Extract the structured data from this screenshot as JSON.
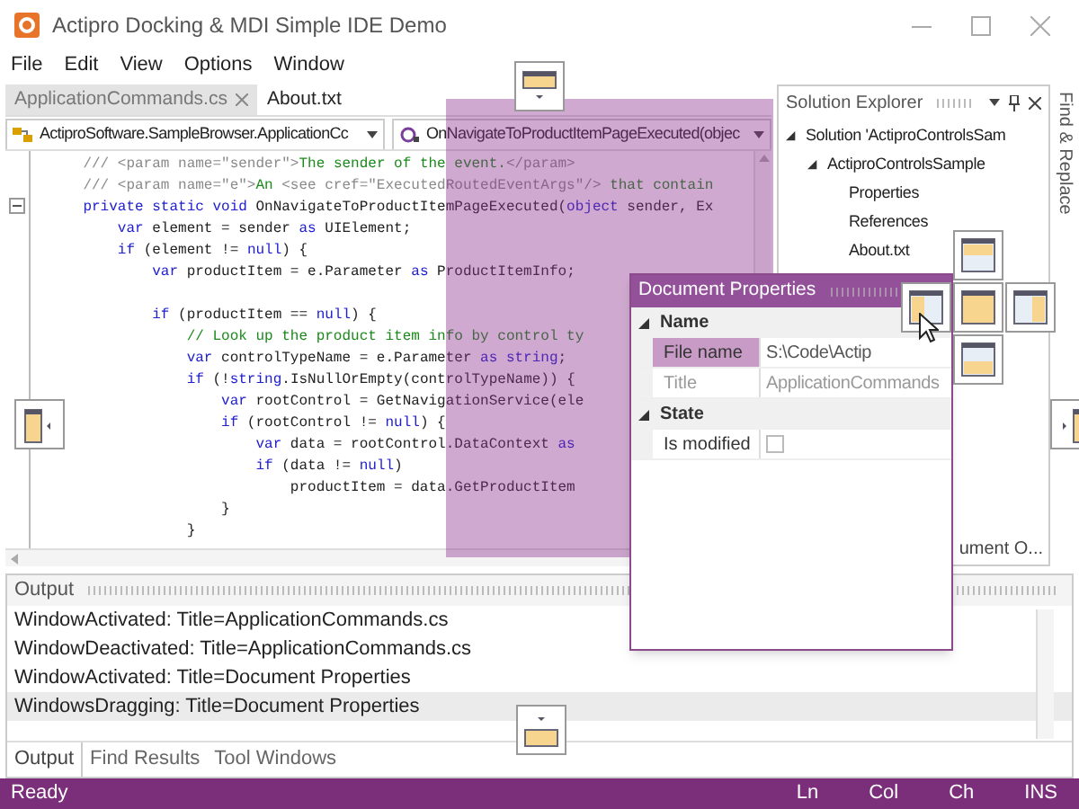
{
  "window": {
    "title": "Actipro Docking & MDI Simple IDE Demo"
  },
  "menu": [
    "File",
    "Edit",
    "View",
    "Options",
    "Window"
  ],
  "document_tabs": [
    {
      "label": "ApplicationCommands.cs",
      "selected": false,
      "closable": true
    },
    {
      "label": "About.txt",
      "selected": true,
      "closable": false
    }
  ],
  "navigation": [
    {
      "kind": "class",
      "text": "ActiproSoftware.SampleBrowser.ApplicationCc"
    },
    {
      "kind": "method",
      "text": "OnNavigateToProductItemPageExecuted(objec"
    }
  ],
  "editor": {
    "lines": [
      {
        "kind": "code",
        "segments": [
          {
            "kind": "doc",
            "text": "    /// <param name=\"sender\">"
          },
          {
            "kind": "comment",
            "text": "The sender of the event."
          },
          {
            "kind": "doc",
            "text": "</param>"
          }
        ]
      },
      {
        "kind": "code",
        "segments": [
          {
            "kind": "doc",
            "text": "    /// <param name=\"e\">"
          },
          {
            "kind": "comment",
            "text": "An "
          },
          {
            "kind": "doc",
            "text": "<see cref=\"ExecutedRoutedEventArgs\"/>"
          },
          {
            "kind": "comment",
            "text": " that contain"
          }
        ]
      },
      {
        "kind": "code",
        "folded": false,
        "segments": [
          {
            "kind": "keyword",
            "text": "    private static void "
          },
          {
            "kind": "plain",
            "text": "OnNavigateToProductItemPageExecuted("
          },
          {
            "kind": "keyword",
            "text": "object"
          },
          {
            "kind": "plain",
            "text": " sender, Ex"
          }
        ]
      },
      {
        "kind": "code",
        "segments": [
          {
            "kind": "keyword",
            "text": "        var"
          },
          {
            "kind": "plain",
            "text": " element = sender "
          },
          {
            "kind": "keyword",
            "text": "as"
          },
          {
            "kind": "plain",
            "text": " UIElement;"
          }
        ]
      },
      {
        "kind": "code",
        "segments": [
          {
            "kind": "keyword",
            "text": "        if"
          },
          {
            "kind": "plain",
            "text": " (element != "
          },
          {
            "kind": "keyword",
            "text": "null"
          },
          {
            "kind": "plain",
            "text": ") {"
          }
        ]
      },
      {
        "kind": "code",
        "segments": [
          {
            "kind": "keyword",
            "text": "            var"
          },
          {
            "kind": "plain",
            "text": " productItem = e.Parameter "
          },
          {
            "kind": "keyword",
            "text": "as"
          },
          {
            "kind": "plain",
            "text": " ProductItemInfo;"
          }
        ]
      },
      {
        "kind": "blank"
      },
      {
        "kind": "code",
        "segments": [
          {
            "kind": "keyword",
            "text": "            if"
          },
          {
            "kind": "plain",
            "text": " (productItem == "
          },
          {
            "kind": "keyword",
            "text": "null"
          },
          {
            "kind": "plain",
            "text": ") {"
          }
        ]
      },
      {
        "kind": "code",
        "segments": [
          {
            "kind": "comment",
            "text": "                // Look up the product item info by control ty"
          }
        ]
      },
      {
        "kind": "code",
        "segments": [
          {
            "kind": "keyword",
            "text": "                var"
          },
          {
            "kind": "plain",
            "text": " controlTypeName = e.Parameter "
          },
          {
            "kind": "keyword",
            "text": "as string"
          },
          {
            "kind": "plain",
            "text": ";"
          }
        ]
      },
      {
        "kind": "code",
        "segments": [
          {
            "kind": "keyword",
            "text": "                if"
          },
          {
            "kind": "plain",
            "text": " (!"
          },
          {
            "kind": "keyword",
            "text": "string"
          },
          {
            "kind": "plain",
            "text": ".IsNullOrEmpty(controlTypeName)) {"
          }
        ]
      },
      {
        "kind": "code",
        "segments": [
          {
            "kind": "keyword",
            "text": "                    var"
          },
          {
            "kind": "plain",
            "text": " rootControl = GetNavigationService(ele"
          }
        ]
      },
      {
        "kind": "code",
        "segments": [
          {
            "kind": "keyword",
            "text": "                    if"
          },
          {
            "kind": "plain",
            "text": " (rootControl != "
          },
          {
            "kind": "keyword",
            "text": "null"
          },
          {
            "kind": "plain",
            "text": ") {"
          }
        ]
      },
      {
        "kind": "code",
        "segments": [
          {
            "kind": "keyword",
            "text": "                        var"
          },
          {
            "kind": "plain",
            "text": " data = rootControl.DataContext "
          },
          {
            "kind": "keyword",
            "text": "as"
          }
        ]
      },
      {
        "kind": "code",
        "segments": [
          {
            "kind": "keyword",
            "text": "                        if"
          },
          {
            "kind": "plain",
            "text": " (data != "
          },
          {
            "kind": "keyword",
            "text": "null"
          },
          {
            "kind": "plain",
            "text": ")"
          }
        ]
      },
      {
        "kind": "code",
        "segments": [
          {
            "kind": "plain",
            "text": "                            productItem = data.GetProductItem"
          }
        ]
      },
      {
        "kind": "code",
        "segments": [
          {
            "kind": "plain",
            "text": "                    }"
          }
        ]
      },
      {
        "kind": "code",
        "segments": [
          {
            "kind": "plain",
            "text": "                }"
          }
        ]
      }
    ]
  },
  "solution_explorer": {
    "title": "Solution Explorer",
    "tree": [
      {
        "label": "Solution 'ActiproControlsSam",
        "expanded": true,
        "children": [
          {
            "label": "ActiproControlsSample",
            "expanded": true,
            "children": [
              {
                "label": "Properties"
              },
              {
                "label": "References"
              },
              {
                "label": "About.txt"
              }
            ]
          }
        ]
      }
    ]
  },
  "side_tabs": [
    {
      "label": "Find & Replace"
    }
  ],
  "hidden_tab": {
    "label": "ument O..."
  },
  "output": {
    "title": "Output",
    "lines": [
      {
        "text": "WindowActivated: Title=ApplicationCommands.cs",
        "selected": false
      },
      {
        "text": "WindowDeactivated: Title=ApplicationCommands.cs",
        "selected": false
      },
      {
        "text": "WindowActivated: Title=Document Properties",
        "selected": false
      },
      {
        "text": "WindowsDragging: Title=Document Properties",
        "selected": true
      }
    ],
    "tabs": [
      {
        "label": "Output",
        "selected": true
      },
      {
        "label": "Find Results",
        "selected": false
      },
      {
        "label": "Tool Windows",
        "selected": false
      }
    ]
  },
  "floating_window": {
    "title": "Document Properties",
    "categories": [
      {
        "name": "Name",
        "expanded": true,
        "properties": [
          {
            "kind": "text",
            "name": "File name",
            "value": "S:\\Code\\Actip",
            "selected": true,
            "disabled": false
          },
          {
            "kind": "text",
            "name": "Title",
            "value": "ApplicationCommands",
            "selected": false,
            "disabled": true
          }
        ]
      },
      {
        "name": "State",
        "expanded": true,
        "properties": [
          {
            "kind": "checkbox",
            "name": "Is modified",
            "checked": false,
            "selected": false,
            "disabled": false
          }
        ]
      }
    ]
  },
  "status_bar": {
    "text": "Ready",
    "indicators": [
      "Ln",
      "Col",
      "Ch",
      "INS"
    ]
  }
}
